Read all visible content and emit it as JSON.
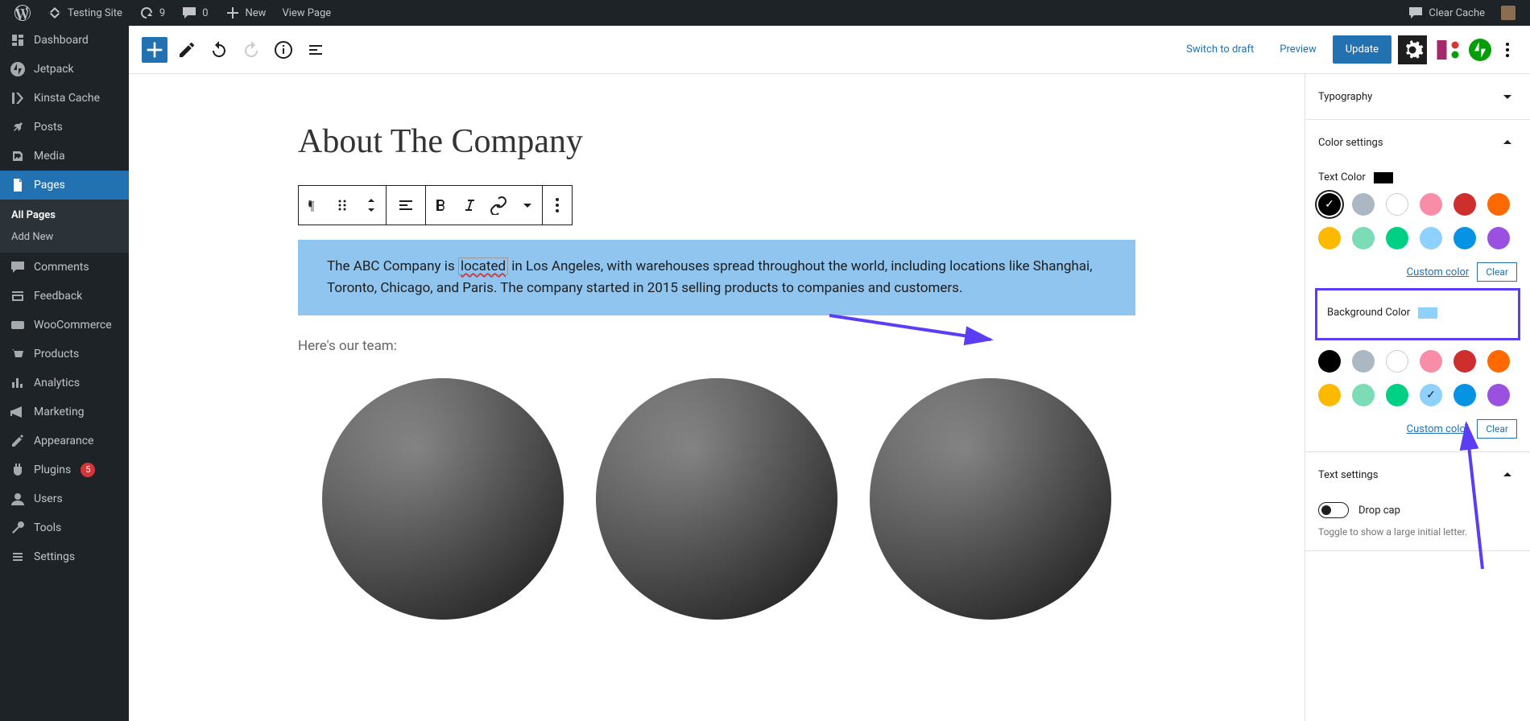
{
  "topbar": {
    "site_name": "Testing Site",
    "updates_count": "9",
    "comments_count": "0",
    "new_label": "New",
    "view_page_label": "View Page",
    "clear_cache_label": "Clear Cache"
  },
  "sidebar": {
    "items": [
      {
        "label": "Dashboard",
        "icon": "dashboard"
      },
      {
        "label": "Jetpack",
        "icon": "jetpack"
      },
      {
        "label": "Kinsta Cache",
        "icon": "kinsta"
      },
      {
        "label": "Posts",
        "icon": "pin"
      },
      {
        "label": "Media",
        "icon": "media"
      },
      {
        "label": "Pages",
        "icon": "pages",
        "active": true
      },
      {
        "label": "Comments",
        "icon": "comments"
      },
      {
        "label": "Feedback",
        "icon": "feedback"
      },
      {
        "label": "WooCommerce",
        "icon": "woo"
      },
      {
        "label": "Products",
        "icon": "products"
      },
      {
        "label": "Analytics",
        "icon": "analytics"
      },
      {
        "label": "Marketing",
        "icon": "marketing"
      },
      {
        "label": "Appearance",
        "icon": "appearance"
      },
      {
        "label": "Plugins",
        "icon": "plugins",
        "badge": "5"
      },
      {
        "label": "Users",
        "icon": "users"
      },
      {
        "label": "Tools",
        "icon": "tools"
      },
      {
        "label": "Settings",
        "icon": "settings"
      }
    ],
    "sub": {
      "all": "All Pages",
      "add": "Add New"
    }
  },
  "header": {
    "switch_draft": "Switch to draft",
    "preview": "Preview",
    "update": "Update"
  },
  "content": {
    "title": "About The Company",
    "para": "The ABC Company is located in Los Angeles, with warehouses spread throughout the world, including locations like Shanghai, Toronto, Chicago, and Paris. The company started in 2015 selling products to companies and customers.",
    "located_word": "located",
    "team_text": "Here's our team:"
  },
  "inspector": {
    "typography": "Typography",
    "color_settings": "Color settings",
    "text_color_label": "Text Color",
    "text_color_value": "#000000",
    "background_color_label": "Background Color",
    "background_color_value": "#90c5ef",
    "custom_color": "Custom color",
    "clear": "Clear",
    "text_settings": "Text settings",
    "drop_cap": "Drop cap",
    "drop_cap_help": "Toggle to show a large initial letter.",
    "palette": [
      {
        "color": "#000000",
        "name": "black"
      },
      {
        "color": "#abb8c3",
        "name": "gray"
      },
      {
        "color": "#ffffff",
        "name": "white",
        "outlined": true
      },
      {
        "color": "#f78da7",
        "name": "pale-pink"
      },
      {
        "color": "#cf2e2e",
        "name": "vivid-red"
      },
      {
        "color": "#ff6900",
        "name": "orange"
      },
      {
        "color": "#fcb900",
        "name": "amber"
      },
      {
        "color": "#7bdcb5",
        "name": "light-green"
      },
      {
        "color": "#00d084",
        "name": "green"
      },
      {
        "color": "#8ed1fc",
        "name": "pale-blue"
      },
      {
        "color": "#0693e3",
        "name": "blue"
      },
      {
        "color": "#9b51e0",
        "name": "purple"
      }
    ]
  }
}
